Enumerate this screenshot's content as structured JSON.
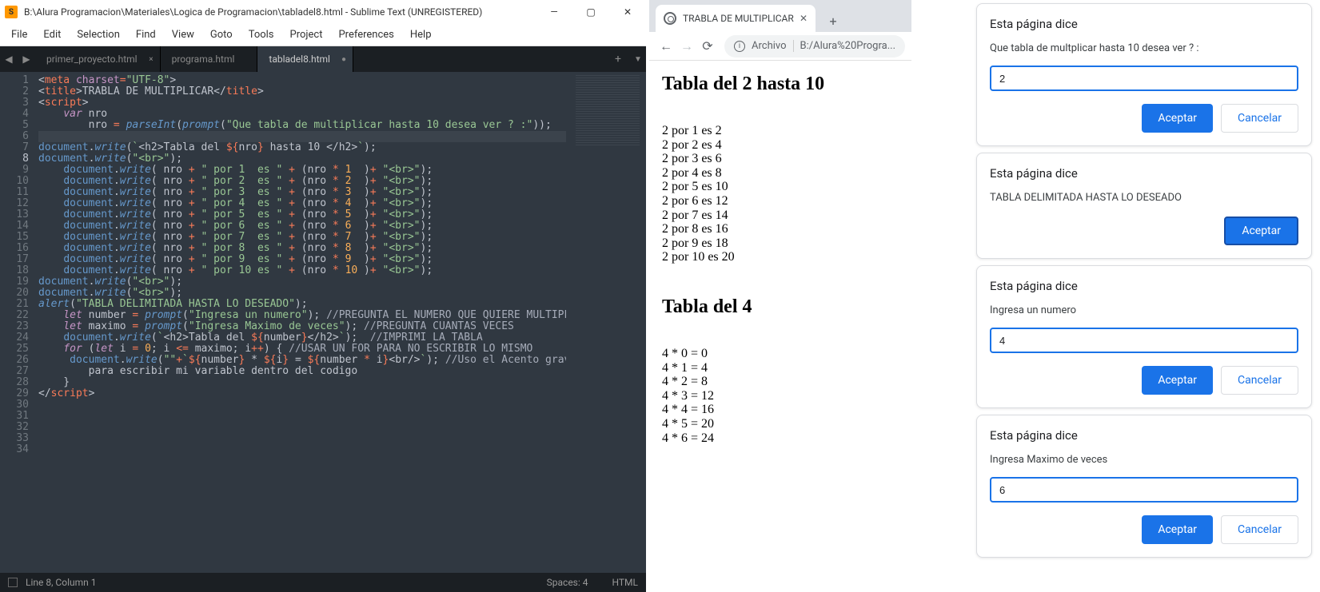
{
  "sublime": {
    "window_title": "B:\\Alura Programacion\\Materiales\\Logica de Programacion\\tabladel8.html - Sublime Text (UNREGISTERED)",
    "menu": [
      "File",
      "Edit",
      "Selection",
      "Find",
      "View",
      "Goto",
      "Tools",
      "Project",
      "Preferences",
      "Help"
    ],
    "tabs": [
      {
        "label": "primer_proyecto.html",
        "active": false,
        "dirty": false
      },
      {
        "label": "programa.html",
        "active": false,
        "dirty": false
      },
      {
        "label": "tabladel8.html",
        "active": true,
        "dirty": true
      }
    ],
    "status": {
      "cursor": "Line 8, Column 1",
      "spaces": "Spaces: 4",
      "syntax": "HTML"
    },
    "active_line": 8,
    "line_count": 34
  },
  "browser": {
    "tab_label": "TRABLA DE MULTIPLICAR",
    "url_type": "Archivo",
    "url_path": "B:/Alura%20Progra...",
    "content": {
      "h1": "Tabla del 2 hasta 10",
      "table1": [
        "2 por 1 es 2",
        "2 por 2 es 4",
        "2 por 3 es 6",
        "2 por 4 es 8",
        "2 por 5 es 10",
        "2 por 6 es 12",
        "2 por 7 es 14",
        "2 por 8 es 16",
        "2 por 9 es 18",
        "2 por 10 es 20"
      ],
      "h2": "Tabla del 4",
      "table2": [
        "4 * 0 = 0",
        "4 * 1 = 4",
        "4 * 2 = 8",
        "4 * 3 = 12",
        "4 * 4 = 16",
        "4 * 5 = 20",
        "4 * 6 = 24"
      ]
    }
  },
  "dialogs": [
    {
      "title": "Esta página dice",
      "message": "Que tabla de multplicar hasta 10 desea ver ? :",
      "has_input": true,
      "input_value": "2",
      "accept": "Aceptar",
      "cancel": "Cancelar",
      "has_cancel": true,
      "accept_focused": false
    },
    {
      "title": "Esta página dice",
      "message": "TABLA DELIMITADA HASTA LO DESEADO",
      "has_input": false,
      "input_value": "",
      "accept": "Aceptar",
      "cancel": "",
      "has_cancel": false,
      "accept_focused": true
    },
    {
      "title": "Esta página dice",
      "message": "Ingresa un numero",
      "has_input": true,
      "input_value": "4",
      "accept": "Aceptar",
      "cancel": "Cancelar",
      "has_cancel": true,
      "accept_focused": false
    },
    {
      "title": "Esta página dice",
      "message": "Ingresa Maximo de veces",
      "has_input": true,
      "input_value": "6",
      "accept": "Aceptar",
      "cancel": "Cancelar",
      "has_cancel": true,
      "accept_focused": false
    }
  ]
}
